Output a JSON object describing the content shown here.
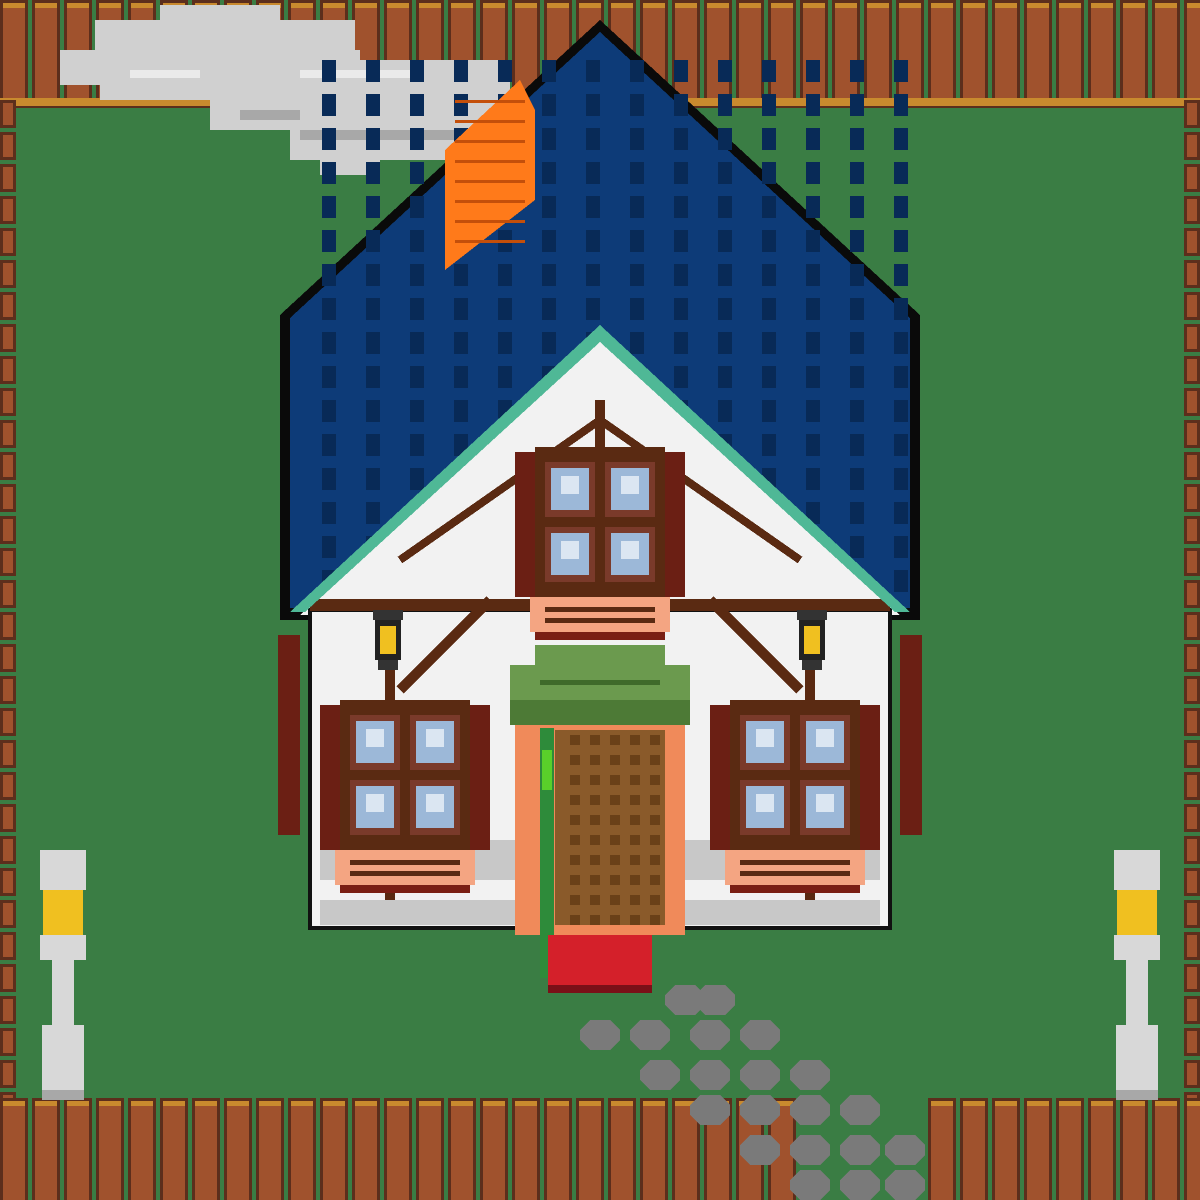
{
  "scene": {
    "kind": "pixel-art cottage",
    "palette": {
      "grass": "#3a7d44",
      "fence": "#a0522d",
      "fence_dark": "#5c2e1c",
      "fence_cap": "#c98a2e",
      "roof": "#0d3b78",
      "roof_dark": "#082a57",
      "roof_line": "#0a0a0a",
      "trim": "#4fb896",
      "wall": "#f2f2f2",
      "wall_shade": "#c8c8c8",
      "timber": "#5a2a12",
      "shutter": "#6b1f14",
      "glass": "#9cb8d8",
      "window_box": "#f4a582",
      "chimney": "#ff7a1a",
      "smoke": "#d0d0d0",
      "awning": "#6b9a4e",
      "door": "#8a5a2a",
      "door_frame": "#f08a5a",
      "door_rail": "#2e8b3a",
      "doormat": "#d4202a",
      "lamp_glow": "#f0c020",
      "lamp_post": "#d8d8d8",
      "stone": "#7a7a7a"
    },
    "icons": [
      "fence-icon",
      "cloud-smoke-icon",
      "chimney-icon",
      "roof-icon",
      "window-icon",
      "wall-lantern-icon",
      "door-icon",
      "doormat-icon",
      "lamp-post-icon",
      "stepping-stone-icon"
    ]
  }
}
